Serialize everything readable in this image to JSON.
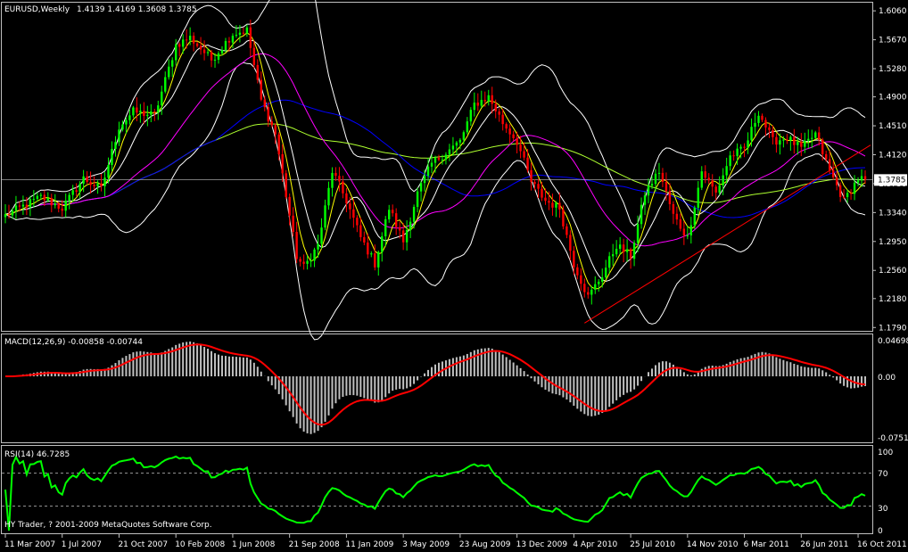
{
  "chart_data": {
    "type": "candlestick",
    "symbol_label": "EURUSD,Weekly",
    "ohlc_label": "1.4139 1.4169 1.3608 1.3785",
    "last_price_label": "1.3785",
    "last_price": 1.3785,
    "price_axis_ticks": [
      "1.6060",
      "1.5670",
      "1.5280",
      "1.4900",
      "1.4510",
      "1.4120",
      "1.3730",
      "1.3340",
      "1.2950",
      "1.2560",
      "1.2180",
      "1.1790"
    ],
    "price_axis_values": [
      1.606,
      1.567,
      1.528,
      1.49,
      1.451,
      1.412,
      1.373,
      1.334,
      1.295,
      1.256,
      1.218,
      1.179
    ],
    "price_range": [
      1.1745,
      1.617
    ],
    "date_ticks": [
      "11 Mar 2007",
      "1 Jul 2007",
      "21 Oct 2007",
      "10 Feb 2008",
      "1 Jun 2008",
      "21 Sep 2008",
      "11 Jan 2009",
      "3 May 2009",
      "23 Aug 2009",
      "13 Dec 2009",
      "4 Apr 2010",
      "25 Jul 2010",
      "14 Nov 2010",
      "6 Mar 2011",
      "26 Jun 2011",
      "16 Oct 2011"
    ],
    "close_path": {
      "x_ticks_index": [
        0,
        16,
        32,
        48,
        64,
        80,
        96,
        112,
        128,
        144,
        160,
        176,
        192,
        208,
        224,
        240
      ],
      "anchors_index": [
        0,
        10,
        16,
        22,
        27,
        32,
        36,
        42,
        48,
        52,
        58,
        64,
        68,
        72,
        76,
        80,
        82,
        84,
        88,
        92,
        96,
        100,
        104,
        108,
        112,
        116,
        120,
        124,
        128,
        132,
        136,
        140,
        144,
        148,
        152,
        156,
        160,
        164,
        168,
        172,
        176,
        180,
        184,
        188,
        192,
        196,
        200,
        204,
        208,
        212,
        216,
        220,
        224,
        228,
        232,
        236,
        240,
        242
      ],
      "anchors_close": [
        1.33,
        1.355,
        1.34,
        1.38,
        1.365,
        1.45,
        1.47,
        1.465,
        1.56,
        1.57,
        1.54,
        1.575,
        1.58,
        1.485,
        1.44,
        1.33,
        1.275,
        1.26,
        1.29,
        1.39,
        1.35,
        1.3,
        1.265,
        1.34,
        1.295,
        1.36,
        1.4,
        1.415,
        1.43,
        1.48,
        1.49,
        1.455,
        1.43,
        1.375,
        1.35,
        1.34,
        1.265,
        1.22,
        1.25,
        1.29,
        1.275,
        1.36,
        1.39,
        1.33,
        1.3,
        1.39,
        1.36,
        1.41,
        1.42,
        1.47,
        1.43,
        1.435,
        1.42,
        1.44,
        1.39,
        1.35,
        1.38,
        1.3785
      ]
    },
    "indicators": {
      "bollinger_color": "#ffffff",
      "ma_fast_color": "#ffff00",
      "ma_mid_color": "#ffffff",
      "ma_slow1_color": "#ff00ff",
      "ma_slow2_color": "#0000ff",
      "ma_slow3_color": "#adff2f",
      "trendline_color": "#ff0000",
      "bull_color": "#00ff00",
      "bear_color": "#ff0000"
    },
    "macd": {
      "label": "MACD(12,26,9) -0.00858 -0.00744",
      "ticks": [
        "0.04698",
        "0.00",
        "-0.07513"
      ],
      "tick_values": [
        0.04698,
        0.0,
        -0.07513
      ],
      "histogram_color": "#c0c0c0",
      "signal_color": "#ff0000"
    },
    "rsi": {
      "label": "RSI(14) 46.7285",
      "ticks": [
        "100",
        "70",
        "30",
        "0"
      ],
      "tick_values": [
        100,
        70,
        30,
        0
      ],
      "levels": [
        70,
        30
      ],
      "line_color": "#00ff00"
    },
    "watermark": "HY Trader, ? 2001-2009 MetaQuotes Software Corp.",
    "colors": {
      "background": "#000000",
      "foreground": "#ffffff",
      "grid": "#c0c0c0",
      "last_price_box": "#ffffff"
    }
  }
}
